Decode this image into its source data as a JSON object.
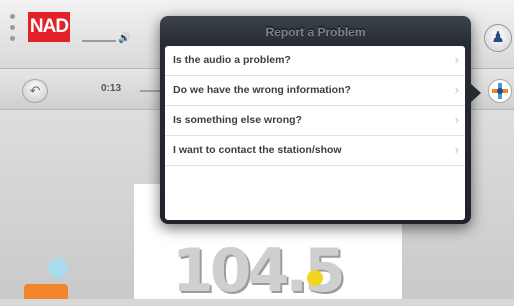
{
  "header": {
    "logo_text": "NAD",
    "volume_icon": "speaker-icon",
    "user_icon": "user-icon"
  },
  "player": {
    "elapsed": "0:13",
    "back_icon": "back-arrow-icon",
    "station_icon": "station-logo-icon"
  },
  "popover": {
    "title": "Report a Problem",
    "items": [
      {
        "label": "Is the audio a problem?"
      },
      {
        "label": "Do we have the wrong information?"
      },
      {
        "label": "Is something else wrong?"
      },
      {
        "label": "I want to contact the station/show"
      }
    ]
  },
  "artwork": {
    "frequency": "104.5"
  },
  "colors": {
    "brand_red": "#e22226",
    "popover_bg": "#262a31",
    "accent_orange": "#f0852b",
    "accent_blue": "#3b9cd9",
    "accent_yellow": "#f2d51f"
  }
}
